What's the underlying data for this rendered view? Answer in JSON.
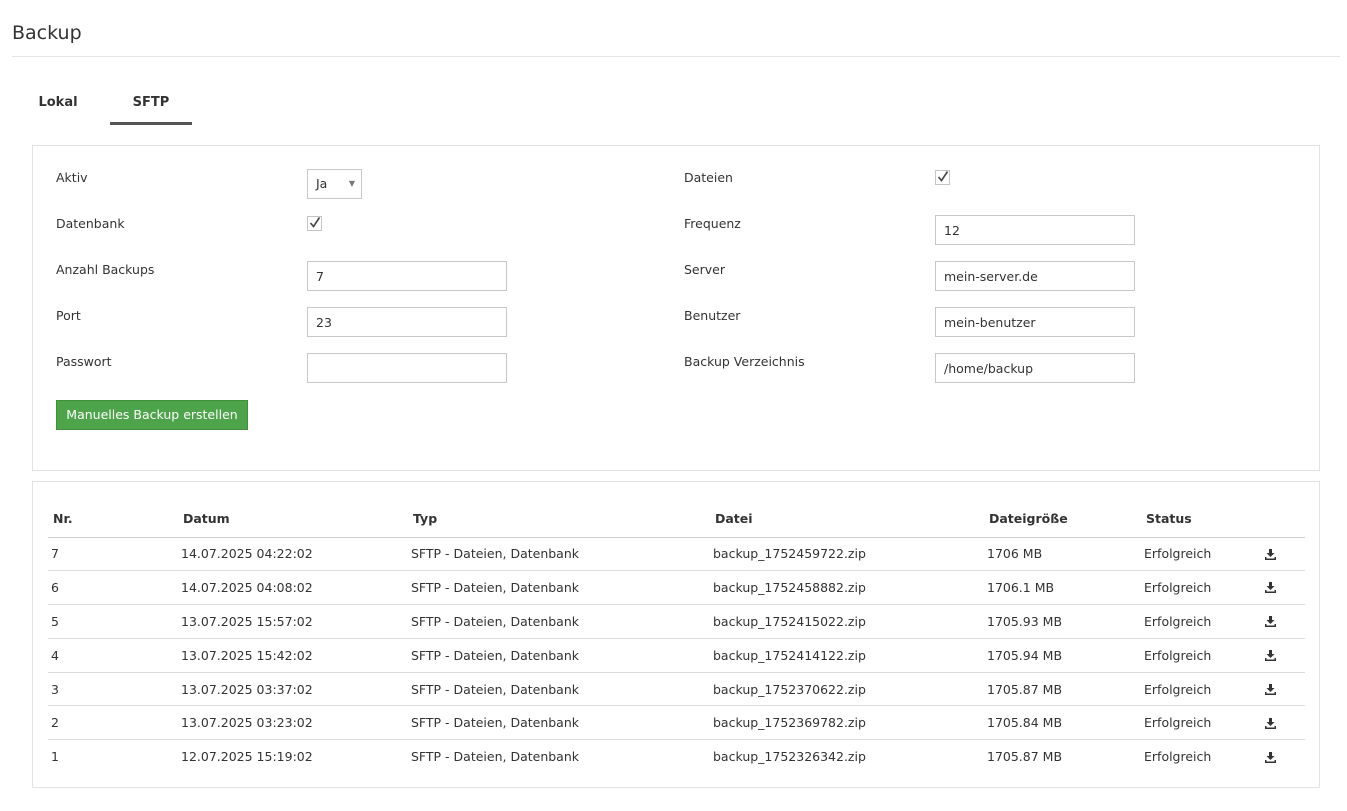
{
  "page": {
    "title": "Backup"
  },
  "tabs": [
    {
      "label": "Lokal",
      "active": false
    },
    {
      "label": "SFTP",
      "active": true
    }
  ],
  "form": {
    "aktiv": {
      "label": "Aktiv",
      "value": "Ja"
    },
    "dateien": {
      "label": "Dateien",
      "checked": true
    },
    "datenbank": {
      "label": "Datenbank",
      "checked": true
    },
    "frequenz": {
      "label": "Frequenz",
      "value": "12"
    },
    "anzahl_backups": {
      "label": "Anzahl Backups",
      "value": "7"
    },
    "server": {
      "label": "Server",
      "value": "mein-server.de"
    },
    "port": {
      "label": "Port",
      "value": "23"
    },
    "benutzer": {
      "label": "Benutzer",
      "value": "mein-benutzer"
    },
    "passwort": {
      "label": "Passwort",
      "value": ""
    },
    "backup_verzeichnis": {
      "label": "Backup Verzeichnis",
      "value": "/home/backup"
    },
    "manual_button": "Manuelles Backup erstellen"
  },
  "table": {
    "headers": [
      "Nr.",
      "Datum",
      "Typ",
      "Datei",
      "Dateigröße",
      "Status"
    ],
    "rows": [
      {
        "nr": "7",
        "datum": "14.07.2025 04:22:02",
        "typ": "SFTP - Dateien, Datenbank",
        "datei": "backup_1752459722.zip",
        "groesse": "1706 MB",
        "status": "Erfolgreich"
      },
      {
        "nr": "6",
        "datum": "14.07.2025 04:08:02",
        "typ": "SFTP - Dateien, Datenbank",
        "datei": "backup_1752458882.zip",
        "groesse": "1706.1 MB",
        "status": "Erfolgreich"
      },
      {
        "nr": "5",
        "datum": "13.07.2025 15:57:02",
        "typ": "SFTP - Dateien, Datenbank",
        "datei": "backup_1752415022.zip",
        "groesse": "1705.93 MB",
        "status": "Erfolgreich"
      },
      {
        "nr": "4",
        "datum": "13.07.2025 15:42:02",
        "typ": "SFTP - Dateien, Datenbank",
        "datei": "backup_1752414122.zip",
        "groesse": "1705.94 MB",
        "status": "Erfolgreich"
      },
      {
        "nr": "3",
        "datum": "13.07.2025 03:37:02",
        "typ": "SFTP - Dateien, Datenbank",
        "datei": "backup_1752370622.zip",
        "groesse": "1705.87 MB",
        "status": "Erfolgreich"
      },
      {
        "nr": "2",
        "datum": "13.07.2025 03:23:02",
        "typ": "SFTP - Dateien, Datenbank",
        "datei": "backup_1752369782.zip",
        "groesse": "1705.84 MB",
        "status": "Erfolgreich"
      },
      {
        "nr": "1",
        "datum": "12.07.2025 15:19:02",
        "typ": "SFTP - Dateien, Datenbank",
        "datei": "backup_1752326342.zip",
        "groesse": "1705.87 MB",
        "status": "Erfolgreich"
      }
    ],
    "row_action_icon": "download-icon"
  },
  "colors": {
    "button_green": "#4ea44a",
    "tab_underline": "#555555"
  }
}
